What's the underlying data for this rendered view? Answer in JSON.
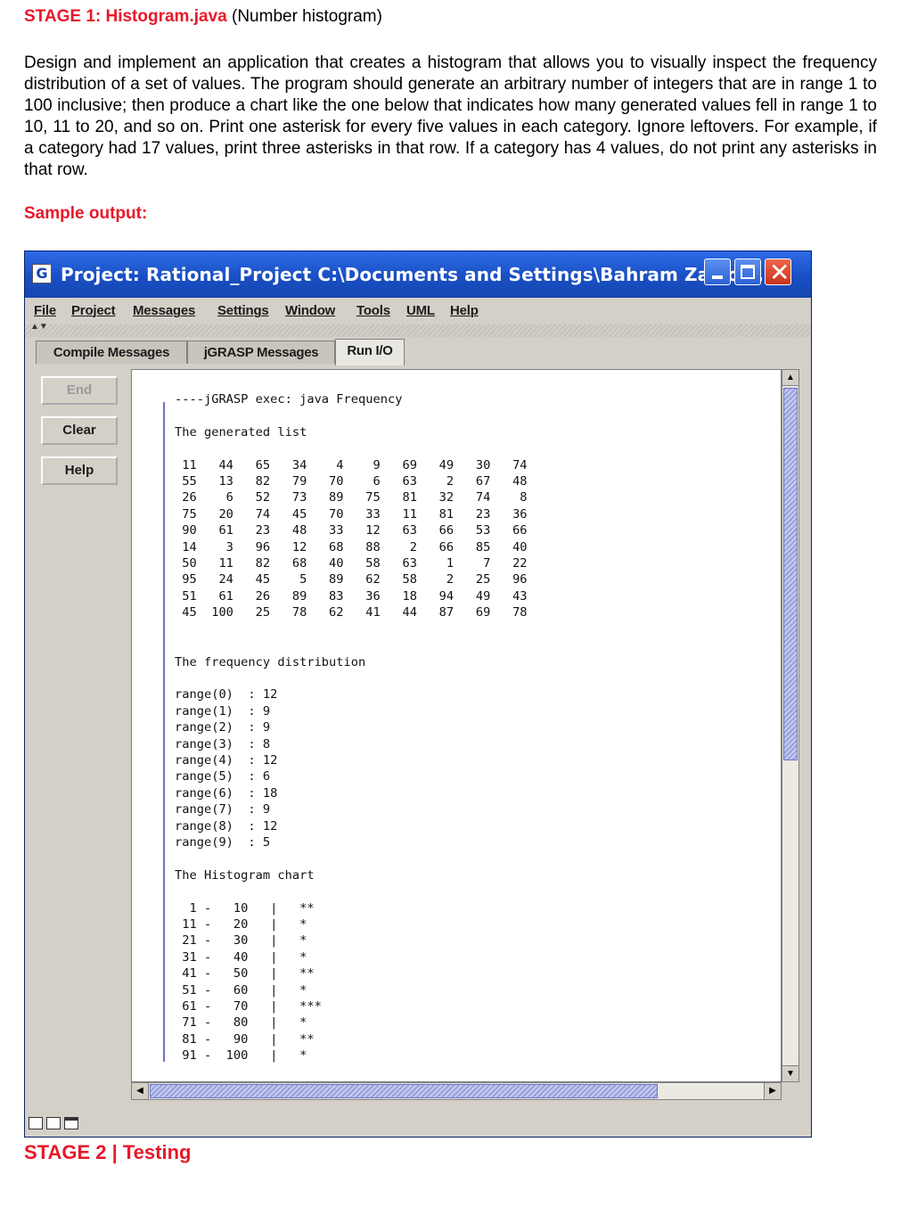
{
  "document": {
    "heading": "STAGE 1: Histogram.java",
    "heading_sub": "(Number histogram)",
    "paragraph": "Design and implement an application that creates a histogram that allows you to visually inspect the frequency distribution of a set of values. The program should generate an arbitrary number of integers that are in range 1 to 100 inclusive; then produce a chart like the one below that indicates how many generated values fell in range 1 to 10, 11 to 20, and so on. Print one asterisk for every five values in each category. Ignore leftovers. For example, if a category had 17 values, print three asterisks in that row. If a category has 4 values, do not print any asterisks in that row.",
    "sample_label": "Sample output:",
    "stage2": "STAGE 2 | Testing"
  },
  "window": {
    "title": "Project: Rational_Project  C:\\Documents and Settings\\Bahram Zartos...",
    "app_icon": "G",
    "menu": [
      "File",
      "Project",
      "Messages",
      "Settings",
      "Window",
      "Tools",
      "UML",
      "Help"
    ],
    "tabs": [
      "Compile Messages",
      "jGRASP Messages",
      "Run I/O"
    ],
    "active_tab": "Run I/O",
    "side_buttons": {
      "end": "End",
      "clear": "Clear",
      "help": "Help"
    },
    "colors": {
      "title_bar": "#1a4fc4",
      "close_button": "#d9401f",
      "accent_text": "#e8182a"
    }
  },
  "console": {
    "exec_line": "----jGRASP exec: java Frequency",
    "generated_header": "The generated list",
    "generated_rows": [
      [
        11,
        44,
        65,
        34,
        4,
        9,
        69,
        49,
        30,
        74
      ],
      [
        55,
        13,
        82,
        79,
        70,
        6,
        63,
        2,
        67,
        48
      ],
      [
        26,
        6,
        52,
        73,
        89,
        75,
        81,
        32,
        74,
        8
      ],
      [
        75,
        20,
        74,
        45,
        70,
        33,
        11,
        81,
        23,
        36
      ],
      [
        90,
        61,
        23,
        48,
        33,
        12,
        63,
        66,
        53,
        66
      ],
      [
        14,
        3,
        96,
        12,
        68,
        88,
        2,
        66,
        85,
        40
      ],
      [
        50,
        11,
        82,
        68,
        40,
        58,
        63,
        1,
        7,
        22
      ],
      [
        95,
        24,
        45,
        5,
        89,
        62,
        58,
        2,
        25,
        96
      ],
      [
        51,
        61,
        26,
        89,
        83,
        36,
        18,
        94,
        49,
        43
      ],
      [
        45,
        100,
        25,
        78,
        62,
        41,
        44,
        87,
        69,
        78
      ]
    ],
    "frequency_header": "The frequency distribution",
    "frequency": [
      {
        "label": "range(0)",
        "count": 12
      },
      {
        "label": "range(1)",
        "count": 9
      },
      {
        "label": "range(2)",
        "count": 9
      },
      {
        "label": "range(3)",
        "count": 8
      },
      {
        "label": "range(4)",
        "count": 12
      },
      {
        "label": "range(5)",
        "count": 6
      },
      {
        "label": "range(6)",
        "count": 18
      },
      {
        "label": "range(7)",
        "count": 9
      },
      {
        "label": "range(8)",
        "count": 12
      },
      {
        "label": "range(9)",
        "count": 5
      }
    ],
    "histogram_header": "The Histogram chart",
    "histogram": [
      {
        "low": 1,
        "high": 10,
        "stars": "**"
      },
      {
        "low": 11,
        "high": 20,
        "stars": "*"
      },
      {
        "low": 21,
        "high": 30,
        "stars": "*"
      },
      {
        "low": 31,
        "high": 40,
        "stars": "*"
      },
      {
        "low": 41,
        "high": 50,
        "stars": "**"
      },
      {
        "low": 51,
        "high": 60,
        "stars": "*"
      },
      {
        "low": 61,
        "high": 70,
        "stars": "***"
      },
      {
        "low": 71,
        "high": 80,
        "stars": "*"
      },
      {
        "low": 81,
        "high": 90,
        "stars": "**"
      },
      {
        "low": 91,
        "high": 100,
        "stars": "*"
      }
    ]
  }
}
